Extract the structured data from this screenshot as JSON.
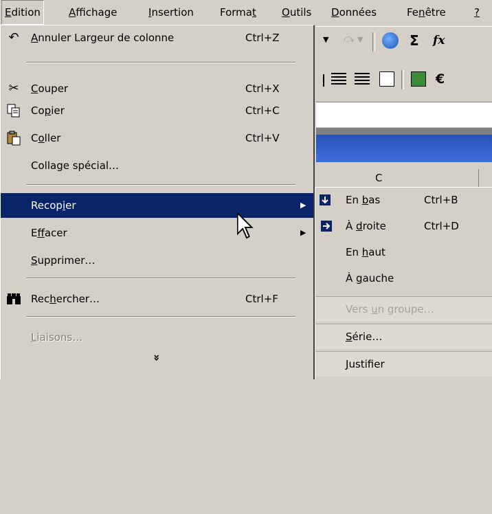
{
  "menubar": {
    "items": [
      {
        "pre": "",
        "u": "E",
        "post": "dition"
      },
      {
        "pre": "",
        "u": "A",
        "post": "ffichage"
      },
      {
        "pre": "",
        "u": "I",
        "post": "nsertion"
      },
      {
        "pre": "Forma",
        "u": "t",
        "post": ""
      },
      {
        "pre": "",
        "u": "O",
        "post": "utils"
      },
      {
        "pre": "",
        "u": "D",
        "post": "onnées"
      },
      {
        "pre": "Fe",
        "u": "n",
        "post": "être"
      },
      {
        "pre": "",
        "u": "?",
        "post": ""
      }
    ]
  },
  "menu": {
    "items": [
      {
        "pre": "",
        "u": "A",
        "post": "nnuler Largeur de colonne",
        "shortcut": "Ctrl+Z",
        "icon": "undo-icon"
      },
      {
        "pre": "",
        "u": "C",
        "post": "ouper",
        "shortcut": "Ctrl+X",
        "icon": "scissors-icon"
      },
      {
        "pre": "Co",
        "u": "p",
        "post": "ier",
        "shortcut": "Ctrl+C",
        "icon": "copy-icon"
      },
      {
        "pre": "C",
        "u": "o",
        "post": "ller",
        "shortcut": "Ctrl+V",
        "icon": "paste-icon"
      },
      {
        "pre": "Colla",
        "u": "g",
        "post": "e spécial…",
        "shortcut": ""
      },
      {
        "pre": "Recop",
        "u": "i",
        "post": "er",
        "shortcut": "",
        "submenu": true,
        "selected": true
      },
      {
        "pre": "E",
        "u": "f",
        "post": "facer",
        "shortcut": "",
        "submenu": true
      },
      {
        "pre": "",
        "u": "S",
        "post": "upprimer…",
        "shortcut": ""
      },
      {
        "pre": "Rec",
        "u": "h",
        "post": "ercher…",
        "shortcut": "Ctrl+F",
        "icon": "binoculars-icon"
      },
      {
        "pre": "",
        "u": "L",
        "post": "iaisons…",
        "shortcut": "",
        "disabled": true
      }
    ],
    "expand_glyph": "»"
  },
  "submenu": {
    "items": [
      {
        "pre": "En ",
        "u": "b",
        "post": "as",
        "shortcut": "Ctrl+B",
        "icon": "fill-down-icon"
      },
      {
        "pre": "À ",
        "u": "d",
        "post": "roite",
        "shortcut": "Ctrl+D",
        "icon": "fill-right-icon"
      },
      {
        "pre": "En ",
        "u": "h",
        "post": "aut",
        "shortcut": ""
      },
      {
        "pre": "À ",
        "u": "g",
        "post": "auche",
        "shortcut": ""
      },
      {
        "pre": "Vers ",
        "u": "u",
        "post": "n groupe…",
        "shortcut": "",
        "disabled": true
      },
      {
        "pre": "",
        "u": "S",
        "post": "érie…",
        "shortcut": ""
      },
      {
        "pre": "",
        "u": "J",
        "post": "ustifier",
        "shortcut": ""
      }
    ]
  },
  "background": {
    "toolbar_glyphs": {
      "sum": "Σ",
      "fx": "fx",
      "euro": "€",
      "column_header": "C"
    }
  }
}
